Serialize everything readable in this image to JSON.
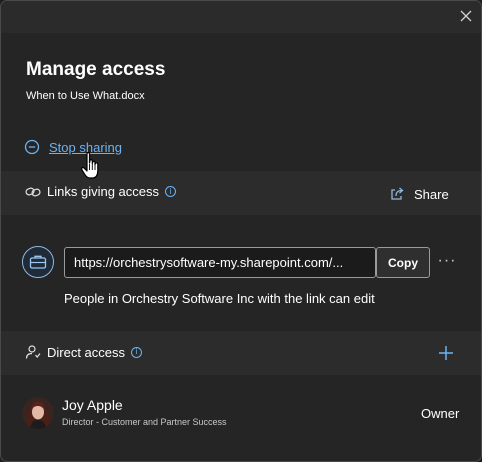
{
  "dialog": {
    "title": "Manage access",
    "subtitle": "When to Use What.docx"
  },
  "stop_sharing": {
    "label": "Stop sharing"
  },
  "links_section": {
    "title": "Links giving access",
    "share_label": "Share",
    "link": {
      "url": "https://orchestrysoftware-my.sharepoint.com/...",
      "copy_label": "Copy",
      "description": "People in Orchestry Software Inc with the link can edit"
    }
  },
  "direct_section": {
    "title": "Direct access",
    "people": [
      {
        "name": "Joy Apple",
        "job_title": "Director - Customer and Partner Success",
        "role": "Owner"
      }
    ]
  },
  "colors": {
    "background": "#252525",
    "band": "#2c2c2c",
    "accent": "#6db3f2",
    "text": "#ffffff"
  },
  "icons": [
    "close-icon",
    "stop-sharing-icon",
    "link-icon",
    "info-icon",
    "share-icon",
    "briefcase-icon",
    "more-icon",
    "person-icon",
    "add-icon",
    "hand-cursor-icon"
  ]
}
